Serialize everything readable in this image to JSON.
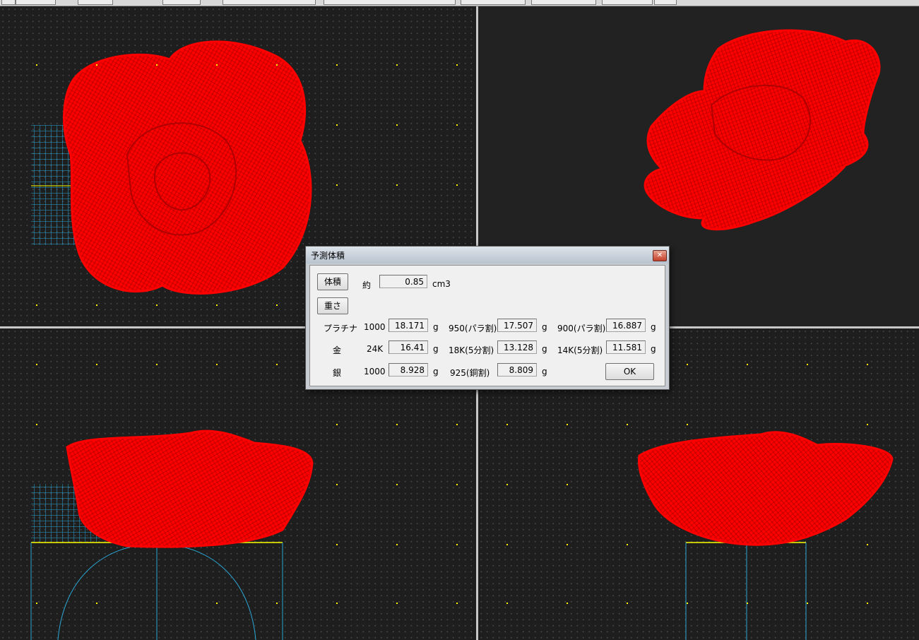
{
  "dialog": {
    "title": "予測体積",
    "close_glyph": "✕",
    "volume_button": "体積",
    "weight_button": "重さ",
    "approx_label": "約",
    "volume_value": "0.85",
    "volume_unit": "cm3",
    "ok_label": "OK",
    "rows": [
      {
        "metal": "プラチナ",
        "cells": [
          {
            "purity": "1000",
            "value": "18.171",
            "unit": "g"
          },
          {
            "purity": "950(パラ割)",
            "value": "17.507",
            "unit": "g"
          },
          {
            "purity": "900(パラ割)",
            "value": "16.887",
            "unit": "g"
          }
        ]
      },
      {
        "metal": "金",
        "cells": [
          {
            "purity": "24K",
            "value": "16.41",
            "unit": "g"
          },
          {
            "purity": "18K(5分割)",
            "value": "13.128",
            "unit": "g"
          },
          {
            "purity": "14K(5分割)",
            "value": "11.581",
            "unit": "g"
          }
        ]
      },
      {
        "metal": "銀",
        "cells": [
          {
            "purity": "1000",
            "value": "8.928",
            "unit": "g"
          },
          {
            "purity": "925(銅割)",
            "value": "8.809",
            "unit": "g"
          }
        ]
      }
    ]
  },
  "colors": {
    "model": "#ff0000",
    "grid": "#2aa7d6",
    "guide": "#ffff00",
    "background": "#1e1e1e"
  }
}
